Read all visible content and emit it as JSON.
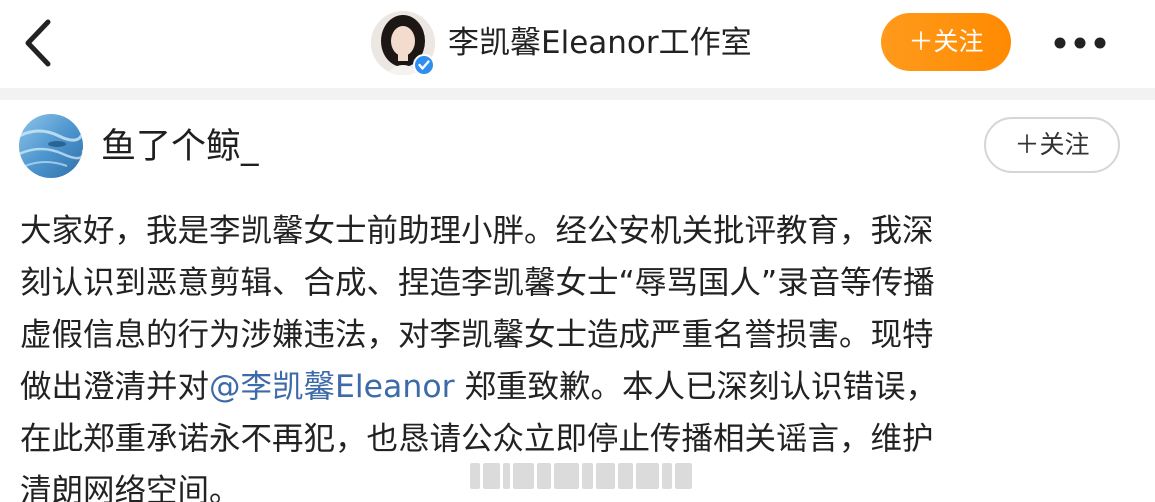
{
  "header": {
    "back_icon": "chevron-left-icon",
    "account_name": "李凯馨Eleanor工作室",
    "verified_icon": "verified-badge-icon",
    "follow_label": "＋关注",
    "more_icon": "more-dots-icon",
    "accent_color": "#ff8a00"
  },
  "post": {
    "author": "鱼了个鲸_",
    "follow_label": "＋关注",
    "body_lines": [
      "大家好，我是李凯馨女士前助理小胖。经公安机关批评教育，我深",
      "刻认识到恶意剪辑、合成、捏造李凯馨女士“辱骂国人”录音等传播",
      "虚假信息的行为涉嫌违法，对李凯馨女士造成严重名誉损害。现特",
      "做出澄清并对",
      "@李凯馨Eleanor",
      " 郑重致歉。本人已深刻认识错误，",
      "在此郑重承诺永不再犯，也恳请公众立即停止传播相关谣言，维护",
      "清朗网络空间。"
    ],
    "mention_color": "#3d6aa8"
  }
}
